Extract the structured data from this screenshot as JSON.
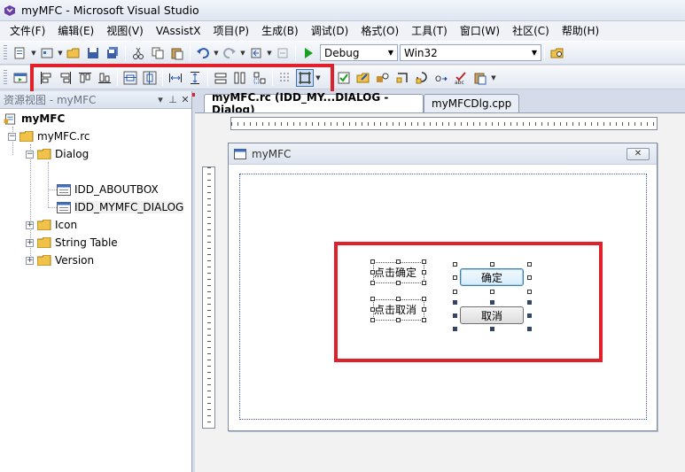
{
  "window": {
    "title": "myMFC - Microsoft Visual Studio"
  },
  "menu": [
    "文件(F)",
    "编辑(E)",
    "视图(V)",
    "VAssistX",
    "项目(P)",
    "生成(B)",
    "调试(D)",
    "格式(O)",
    "工具(T)",
    "窗口(W)",
    "社区(C)",
    "帮助(H)"
  ],
  "toolbar": {
    "config": "Debug",
    "platform": "Win32"
  },
  "panel": {
    "title": "资源视图 - myMFC",
    "pin": "▾ ⊥ ✕",
    "tree": {
      "project": "myMFC",
      "rc": "myMFC.rc",
      "dialog": "Dialog",
      "aboutbox": "IDD_ABOUTBOX",
      "mainDialog": "IDD_MYMFC_DIALOG",
      "icon": "Icon",
      "stringTable": "String Table",
      "version": "Version"
    }
  },
  "tabs": {
    "active": "myMFC.rc (IDD_MY...DIALOG - Dialog)",
    "inactive": "myMFCDlg.cpp"
  },
  "designer": {
    "dialogTitle": "myMFC",
    "closeGlyph": "✕",
    "static1": "点击确定",
    "static2": "点击取消",
    "okButton": "确定",
    "cancelButton": "取消"
  },
  "colors": {
    "highlight": "#e0202a",
    "selection": "#3c7fb1"
  }
}
